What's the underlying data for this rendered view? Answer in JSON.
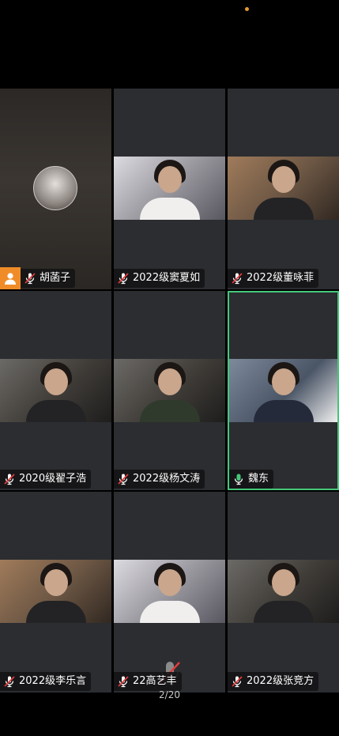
{
  "participants": [
    {
      "name": "胡菡子",
      "mic": "muted",
      "video": false,
      "host": true
    },
    {
      "name": "2022级窦夏如",
      "mic": "muted",
      "video": true
    },
    {
      "name": "2022级董咏菲",
      "mic": "muted",
      "video": true
    },
    {
      "name": "2020级翟子浩",
      "mic": "muted",
      "video": true
    },
    {
      "name": "2022级杨文涛",
      "mic": "muted",
      "video": true
    },
    {
      "name": "魏东",
      "mic": "active",
      "video": true,
      "speaking": true
    },
    {
      "name": "2022级李乐言",
      "mic": "muted",
      "video": true
    },
    {
      "name": "22高艺丰",
      "mic": "muted",
      "video": true
    },
    {
      "name": "2022级张竞方",
      "mic": "muted",
      "video": true
    }
  ],
  "pagination": {
    "label": "2/20"
  },
  "colors": {
    "speaker_border": "#44c87a",
    "mic_muted": "#ffffff",
    "mic_active": "#44c87a",
    "mute_slash": "#e23b3b",
    "host_badge": "#f08c28"
  }
}
